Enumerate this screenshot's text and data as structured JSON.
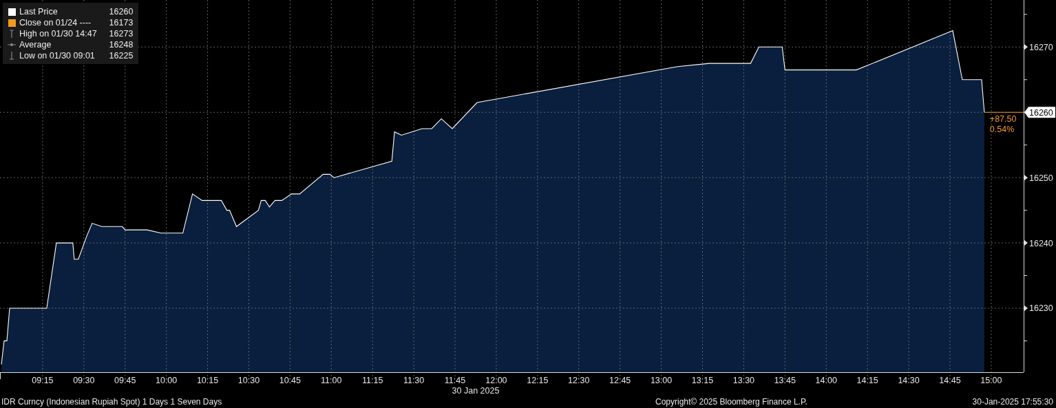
{
  "legend": [
    {
      "kind": "square",
      "color": "#ffffff",
      "value": "16260"
    },
    {
      "kind": "square",
      "color": "#f39a1d",
      "label": "Close on 01/24 ----",
      "value": "16173"
    },
    {
      "kind": "high",
      "label": "High on 01/30 14:47",
      "value": "16273"
    },
    {
      "kind": "average",
      "label": "Average",
      "value": "16248"
    },
    {
      "kind": "low",
      "label": "Low on 01/30 09:01",
      "value": "16225"
    }
  ],
  "chart_data": {
    "type": "area",
    "xlabel": "30 Jan 2025",
    "grid": true,
    "x": [
      9,
      9.0167,
      9.0333,
      9.05,
      9.275,
      9.3333,
      9.4333,
      9.4417,
      9.4667,
      9.5167,
      9.55,
      9.6083,
      9.7333,
      9.75,
      9.8833,
      9.9667,
      10.1,
      10.1583,
      10.2167,
      10.3333,
      10.3667,
      10.3833,
      10.425,
      10.5583,
      10.575,
      10.6,
      10.625,
      10.6583,
      10.7,
      10.7583,
      10.8083,
      10.95,
      10.9917,
      11.0167,
      11.3667,
      11.3833,
      11.425,
      11.55,
      11.6083,
      11.6667,
      11.7333,
      11.8833,
      13.1,
      13.2917,
      13.5417,
      13.5917,
      13.7333,
      13.75,
      14.1833,
      14.7667,
      14.825,
      14.9417,
      14.9583
    ],
    "series": [
      {
        "name": "Last Price",
        "color": "#ffffff",
        "values": [
          16221.4,
          16225,
          16225,
          16230,
          16230,
          16240,
          16240,
          16237.5,
          16237.5,
          16241,
          16243,
          16242.5,
          16242.5,
          16242,
          16242,
          16241.5,
          16241.5,
          16247.5,
          16246.5,
          16246.5,
          16245,
          16245,
          16242.5,
          16245,
          16246.5,
          16246.5,
          16245.5,
          16246.5,
          16246.5,
          16247.5,
          16247.5,
          16250.5,
          16250.5,
          16250,
          16252.5,
          16257,
          16256.5,
          16257.5,
          16257.5,
          16259,
          16257.5,
          16261.5,
          16267,
          16267.5,
          16267.5,
          16270,
          16270,
          16266.5,
          16266.5,
          16272.5,
          16265,
          16265,
          16260
        ]
      }
    ],
    "xlim": [
      8.9917,
      15.1967
    ],
    "ylim": [
      16220.2,
      16277.2
    ],
    "xticks": [
      {
        "value": 9.25,
        "label": "09:15"
      },
      {
        "value": 9.5,
        "label": "09:30"
      },
      {
        "value": 9.75,
        "label": "09:45"
      },
      {
        "value": 10,
        "label": "10:00"
      },
      {
        "value": 10.25,
        "label": "10:15"
      },
      {
        "value": 10.5,
        "label": "10:30"
      },
      {
        "value": 10.75,
        "label": "10:45"
      },
      {
        "value": 11,
        "label": "11:00"
      },
      {
        "value": 11.25,
        "label": "11:15"
      },
      {
        "value": 11.5,
        "label": "11:30"
      },
      {
        "value": 11.75,
        "label": "11:45"
      },
      {
        "value": 12,
        "label": "12:00"
      },
      {
        "value": 12.25,
        "label": "12:15"
      },
      {
        "value": 12.5,
        "label": "12:30"
      },
      {
        "value": 12.75,
        "label": "12:45"
      },
      {
        "value": 13,
        "label": "13:00"
      },
      {
        "value": 13.25,
        "label": "13:15"
      },
      {
        "value": 13.5,
        "label": "13:30"
      },
      {
        "value": 13.75,
        "label": "13:45"
      },
      {
        "value": 14,
        "label": "14:00"
      },
      {
        "value": 14.25,
        "label": "14:15"
      },
      {
        "value": 14.5,
        "label": "14:30"
      },
      {
        "value": 14.75,
        "label": "14:45"
      },
      {
        "value": 15,
        "label": "15:00"
      }
    ],
    "yticks": [
      16230,
      16240,
      16250,
      16260,
      16270
    ]
  },
  "last_marker": {
    "value": "16260",
    "change": "+87.50",
    "change_percent": "0.54%"
  },
  "footer": {
    "security": "IDR Curncy (Indonesian Rupiah Spot) 1 Days 1 Seven Days",
    "copyright": "Copyright© 2025 Bloomberg Finance L.P.",
    "timestamp": "30-Jan-2025 17:55:30"
  }
}
